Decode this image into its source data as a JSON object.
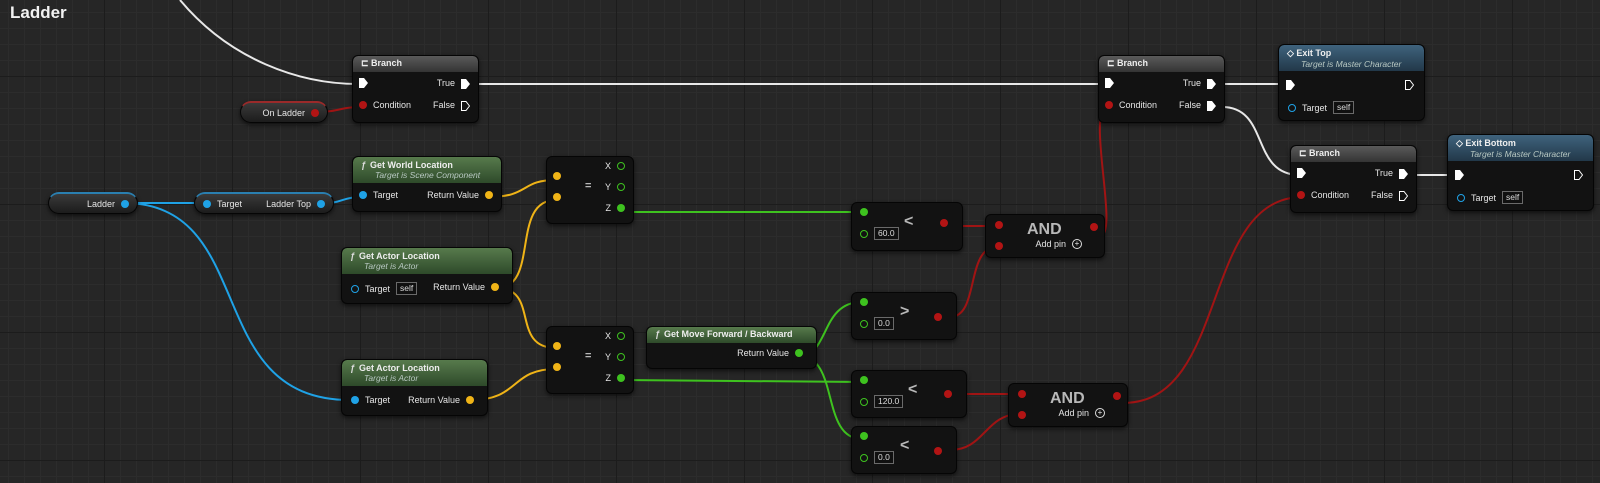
{
  "graph_title": "Ladder",
  "branch_title": "Branch",
  "pins": {
    "true": "True",
    "false": "False",
    "condition": "Condition",
    "target": "Target",
    "return_value": "Return Value",
    "x": "X",
    "y": "Y",
    "z": "Z",
    "self": "self",
    "add_pin": "Add pin"
  },
  "vars": {
    "on_ladder": "On Ladder",
    "ladder": "Ladder",
    "ladder_top": "Ladder Top"
  },
  "functions": {
    "get_world_location": {
      "title": "Get World Location",
      "sub": "Target is Scene Component"
    },
    "get_actor_location": {
      "title": "Get Actor Location",
      "sub": "Target is Actor"
    },
    "get_move_forward_backward": {
      "title": "Get Move Forward / Backward"
    },
    "exit_top": {
      "title": "Exit Top",
      "sub": "Target is Master Character"
    },
    "exit_bottom": {
      "title": "Exit Bottom",
      "sub": "Target is Master Character"
    }
  },
  "ops": {
    "and": "AND",
    "less": "<",
    "greater": ">",
    "break": "="
  },
  "compare_values": {
    "c1": "60.0",
    "c2": "0.0",
    "c3": "120.0",
    "c4": "0.0"
  },
  "colors": {
    "exec": "#ffffff",
    "bool": "#b21414",
    "object": "#1fa2e6",
    "vector": "#f0b417",
    "float": "#3ec21f"
  }
}
